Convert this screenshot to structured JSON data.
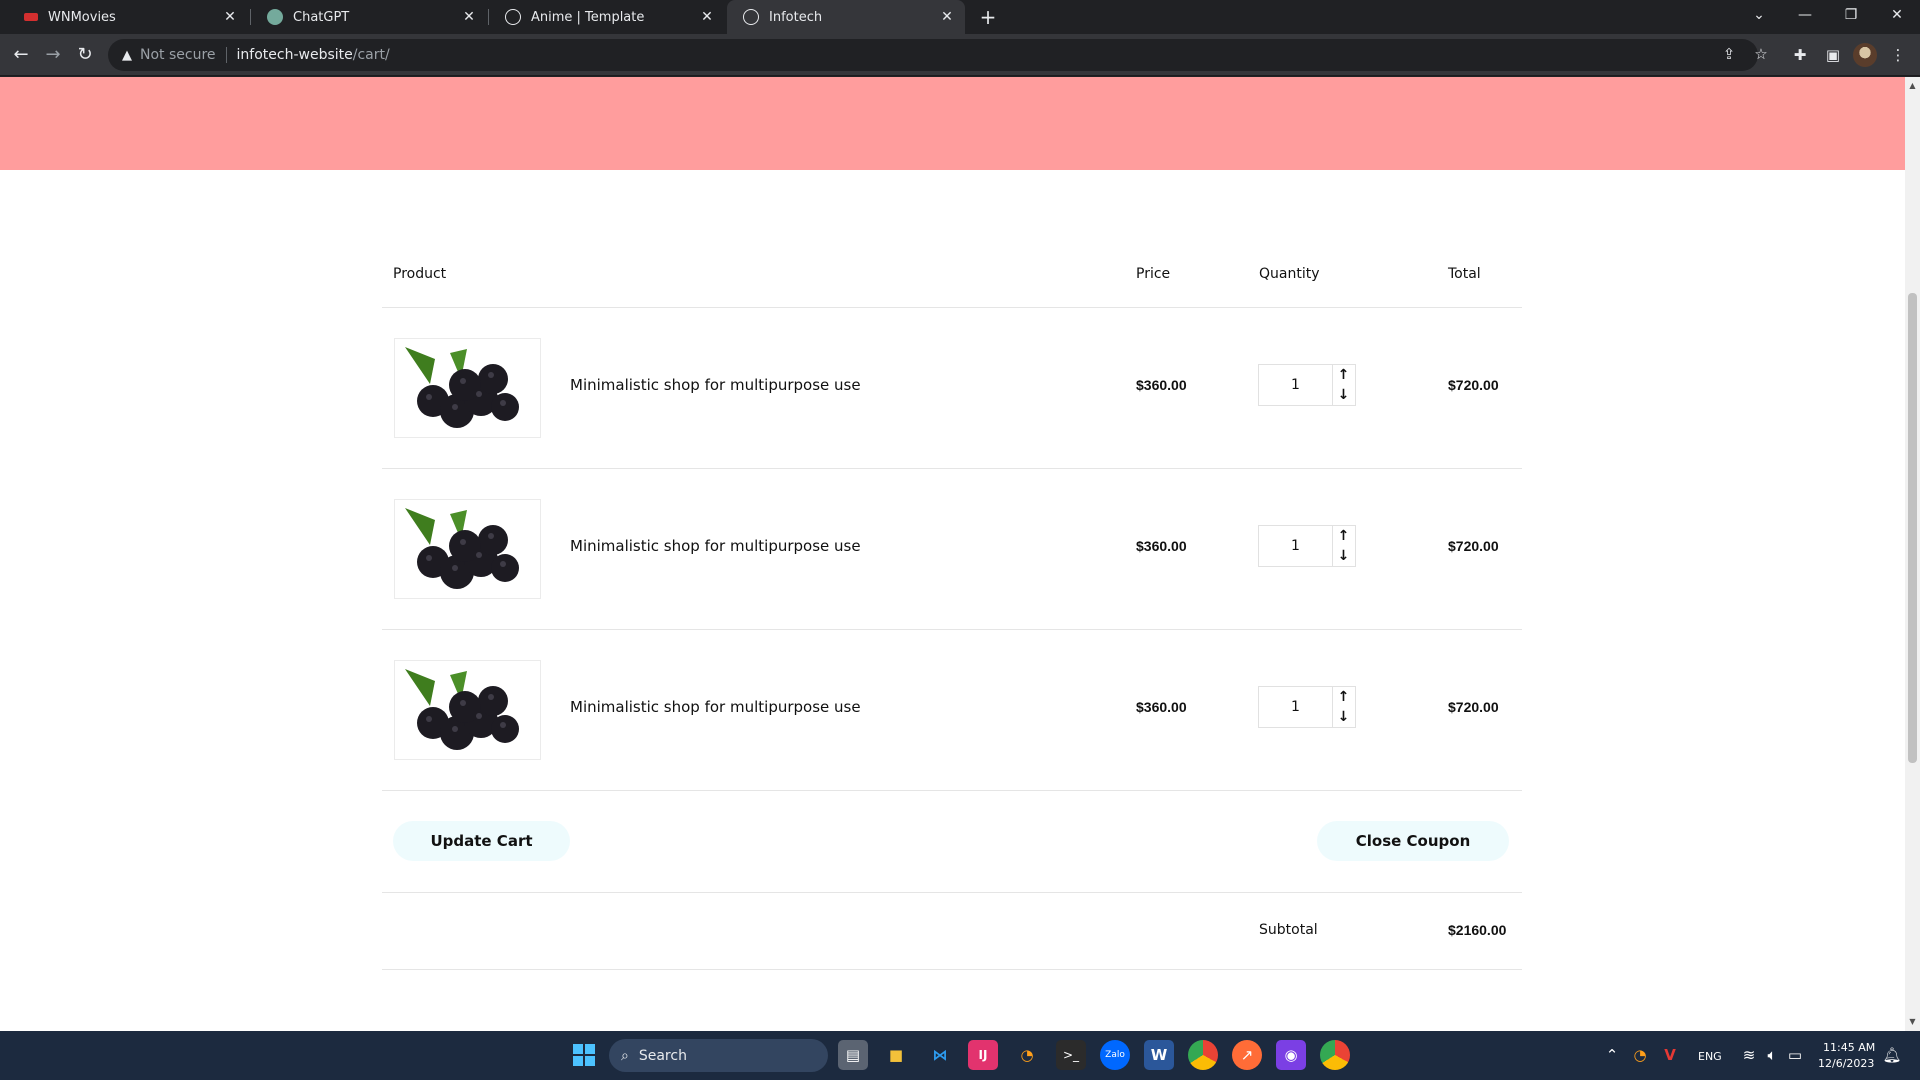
{
  "browser": {
    "tabs": [
      {
        "title": "WNMovies",
        "active": false
      },
      {
        "title": "ChatGPT",
        "active": false
      },
      {
        "title": "Anime | Template",
        "active": false
      },
      {
        "title": "Infotech",
        "active": true
      }
    ],
    "new_tab_label": "+",
    "security_label": "Not secure",
    "url_host": "infotech-website",
    "url_path": "/cart/"
  },
  "cart": {
    "headers": {
      "product": "Product",
      "price": "Price",
      "quantity": "Quantity",
      "total": "Total"
    },
    "items": [
      {
        "name": "Minimalistic shop for multipurpose use",
        "price": "$360.00",
        "quantity": "1",
        "total": "$720.00"
      },
      {
        "name": "Minimalistic shop for multipurpose use",
        "price": "$360.00",
        "quantity": "1",
        "total": "$720.00"
      },
      {
        "name": "Minimalistic shop for multipurpose use",
        "price": "$360.00",
        "quantity": "1",
        "total": "$720.00"
      }
    ],
    "update_cart_label": "Update Cart",
    "close_coupon_label": "Close Coupon",
    "subtotal_label": "Subtotal",
    "subtotal_value": "$2160.00"
  },
  "colors": {
    "hero": "#ff9d9d",
    "button_bg": "#eefbfd",
    "taskbar": "#1c2a3f"
  },
  "taskbar": {
    "search_label": "Search",
    "language": "ENG",
    "time": "11:45 AM",
    "date": "12/6/2023",
    "zalo_label": "Zalo"
  }
}
